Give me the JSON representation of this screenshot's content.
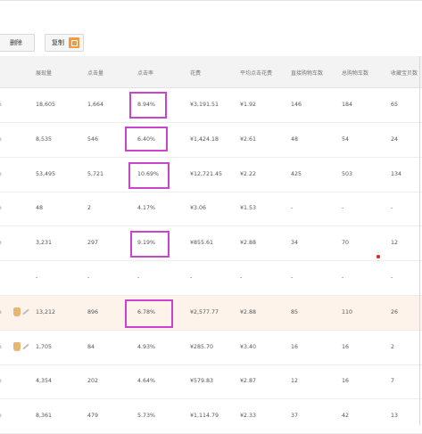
{
  "toolbar": {
    "delete_label": "删除",
    "copy_label": "复制"
  },
  "table": {
    "columns": [
      "展现量",
      "点击量",
      "点击率",
      "花费",
      "平均点击花费",
      "直接购物车数",
      "总购物车数",
      "收藏宝贝数"
    ],
    "rows": [
      {
        "lead": "o",
        "cells": [
          "18,605",
          "1,664",
          "8.94%",
          "¥3,191.51",
          "¥1.92",
          "146",
          "184",
          "65"
        ]
      },
      {
        "lead": "o",
        "cells": [
          "8,535",
          "546",
          "6.40%",
          "¥1,424.18",
          "¥2.61",
          "48",
          "54",
          "24"
        ]
      },
      {
        "lead": "o",
        "cells": [
          "53,495",
          "5,721",
          "10.69%",
          "¥12,721.45",
          "¥2.22",
          "425",
          "503",
          "134"
        ]
      },
      {
        "lead": "o",
        "cells": [
          "48",
          "2",
          "4.17%",
          "¥3.06",
          "¥1.53",
          "-",
          "-",
          "-"
        ]
      },
      {
        "lead": "o",
        "cells": [
          "3,231",
          "297",
          "9.19%",
          "¥855.61",
          "¥2.88",
          "34",
          "70",
          "12"
        ]
      },
      {
        "lead": "-",
        "cells": [
          "-",
          "-",
          "-",
          "-",
          "-",
          "-",
          "-",
          "-"
        ]
      },
      {
        "lead": "o",
        "cells": [
          "13,212",
          "896",
          "6.78%",
          "¥2,577.77",
          "¥2.88",
          "85",
          "110",
          "26"
        ]
      },
      {
        "lead": "o",
        "cells": [
          "1,705",
          "84",
          "4.93%",
          "¥285.70",
          "¥3.40",
          "16",
          "16",
          "2"
        ]
      },
      {
        "lead": "o",
        "cells": [
          "4,354",
          "202",
          "4.64%",
          "¥579.83",
          "¥2.87",
          "12",
          "16",
          "7"
        ]
      },
      {
        "lead": "o",
        "cells": [
          "8,361",
          "479",
          "5.73%",
          "¥1,114.79",
          "¥2.33",
          "37",
          "42",
          "13"
        ]
      }
    ]
  },
  "colors": {
    "highlight_box": "#cc44cc",
    "highlight_row": "#fdf3ea",
    "copy_icon": "#f29b38"
  }
}
